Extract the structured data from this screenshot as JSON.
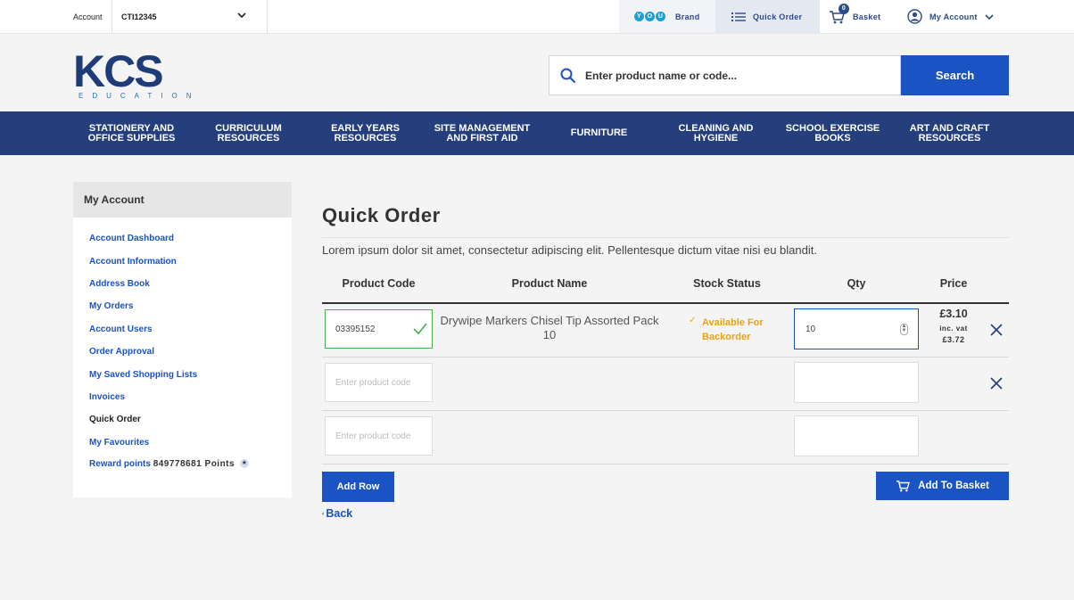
{
  "topbar": {
    "account_label": "Account",
    "account_value": "CTI12345",
    "you_letters": [
      "Y",
      "O",
      "U"
    ],
    "brand_label": "Brand",
    "quick_order_label": "Quick Order",
    "basket_label": "Basket",
    "basket_count": "0",
    "my_account_label": "My Account"
  },
  "header": {
    "logo_text": "KCS",
    "logo_sub": "EDUCATION",
    "search_placeholder": "Enter product name or code...",
    "search_button": "Search"
  },
  "nav": {
    "items": [
      {
        "line1": "Stationery and",
        "line2": "Office Supplies"
      },
      {
        "line1": "Curriculum",
        "line2": "Resources"
      },
      {
        "line1": "Early Years",
        "line2": "Resources"
      },
      {
        "line1": "Site Management",
        "line2": "and First Aid"
      },
      {
        "line1": "Furniture",
        "line2": ""
      },
      {
        "line1": "Cleaning and",
        "line2": "Hygiene"
      },
      {
        "line1": "School Exercise",
        "line2": "Books"
      },
      {
        "line1": "Art and Craft",
        "line2": "Resources"
      }
    ]
  },
  "sidebar": {
    "title": "My Account",
    "items": [
      "Account Dashboard",
      "Account Information",
      "Address Book",
      "My Orders",
      "Account Users",
      "Order Approval",
      "My Saved Shopping Lists",
      "Invoices",
      "Quick Order",
      "My Favourites"
    ],
    "reward_label": "Reward points",
    "reward_value": "849778681 Points"
  },
  "main": {
    "title": "Quick Order",
    "intro": "Lorem ipsum dolor sit amet, consectetur adipiscing elit. Pellentesque dictum vitae nisi eu blandit.",
    "columns": [
      "Product Code",
      "Product Name",
      "Stock Status",
      "Qty",
      "Price"
    ],
    "code_placeholder": "Enter product code",
    "row1": {
      "code": "03395152",
      "name": "Drywipe Markers Chisel Tip Assorted Pack 10",
      "stock_line1": "Available For",
      "stock_line2": "Backorder",
      "qty": "10",
      "price": "£3.10",
      "vat_label": "inc. vat",
      "price_inc": "£3.72"
    },
    "remove_label": "X",
    "add_row": "Add Row",
    "add_basket": "Add To Basket",
    "back": "Back"
  },
  "colors": {
    "primary": "#1a53c4",
    "nav": "#253f7c",
    "stock": "#e8a21a",
    "valid": "#4caf50"
  }
}
